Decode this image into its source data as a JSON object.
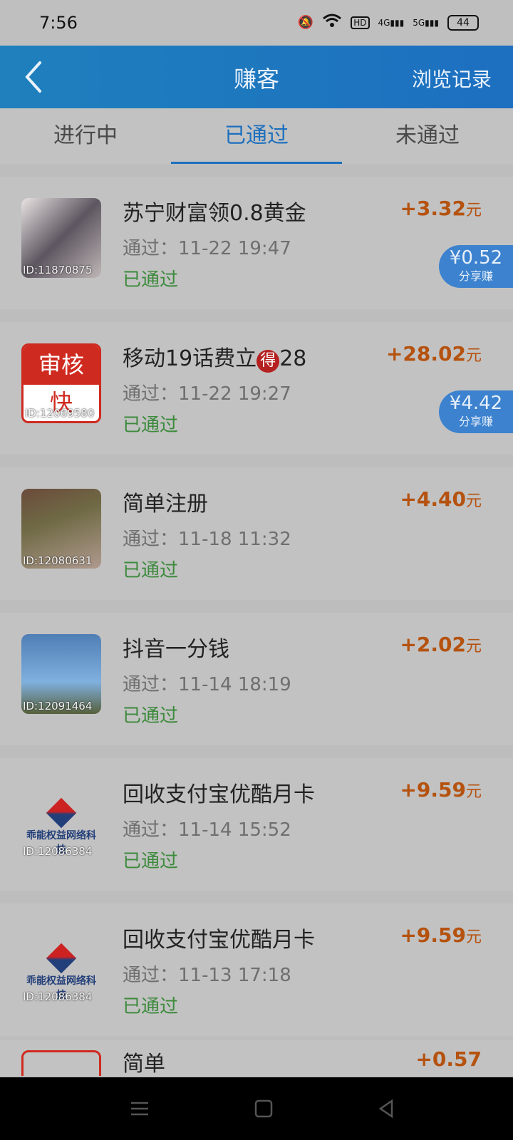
{
  "status_bar": {
    "time": "7:56",
    "battery": "44",
    "icons": [
      "mute-icon",
      "wifi-icon",
      "hd-icon",
      "4g-signal-icon",
      "5g-signal-icon",
      "battery-icon"
    ]
  },
  "appbar": {
    "title": "赚客",
    "history": "浏览记录"
  },
  "tabs": [
    {
      "label": "进行中",
      "active": false
    },
    {
      "label": "已通过",
      "active": true
    },
    {
      "label": "未通过",
      "active": false
    }
  ],
  "items": [
    {
      "id": "ID:11870875",
      "name": "苏宁财富领0.8黄金",
      "date": "通过：11-22 19:47",
      "status": "已通过",
      "amount": "+3.32",
      "unit": "元",
      "share_value": "¥0.52",
      "share_label": "分享赚"
    },
    {
      "id": "ID:12069580",
      "name_a": "移动19话费立",
      "badge": "得",
      "name_b": "28",
      "date": "通过：11-22 19:27",
      "status": "已通过",
      "amount": "+28.02",
      "unit": "元",
      "share_value": "¥4.42",
      "share_label": "分享赚",
      "logo_top": "审核",
      "logo_bottom": "快"
    },
    {
      "id": "ID:12080631",
      "name": "简单注册",
      "date": "通过：11-18 11:32",
      "status": "已通过",
      "amount": "+4.40",
      "unit": "元"
    },
    {
      "id": "ID:12091464",
      "name": "抖音一分钱",
      "date": "通过：11-14 18:19",
      "status": "已通过",
      "amount": "+2.02",
      "unit": "元"
    },
    {
      "id": "ID:12086384",
      "name": "回收支付宝优酷月卡",
      "date": "通过：11-14 15:52",
      "status": "已通过",
      "amount": "+9.59",
      "unit": "元",
      "logo_text": "乖能权益网络科技"
    },
    {
      "id": "ID:12086384",
      "name": "回收支付宝优酷月卡",
      "date": "通过：11-13 17:18",
      "status": "已通过",
      "amount": "+9.59",
      "unit": "元",
      "logo_text": "乖能权益网络科技"
    }
  ],
  "partial_item": {
    "name": "简单",
    "amount": "+0.57"
  },
  "colors": {
    "appbar": "#1f80bd",
    "accent": "#1c6fbe",
    "amount": "#b5520f",
    "status_ok": "#3c8a3c"
  }
}
